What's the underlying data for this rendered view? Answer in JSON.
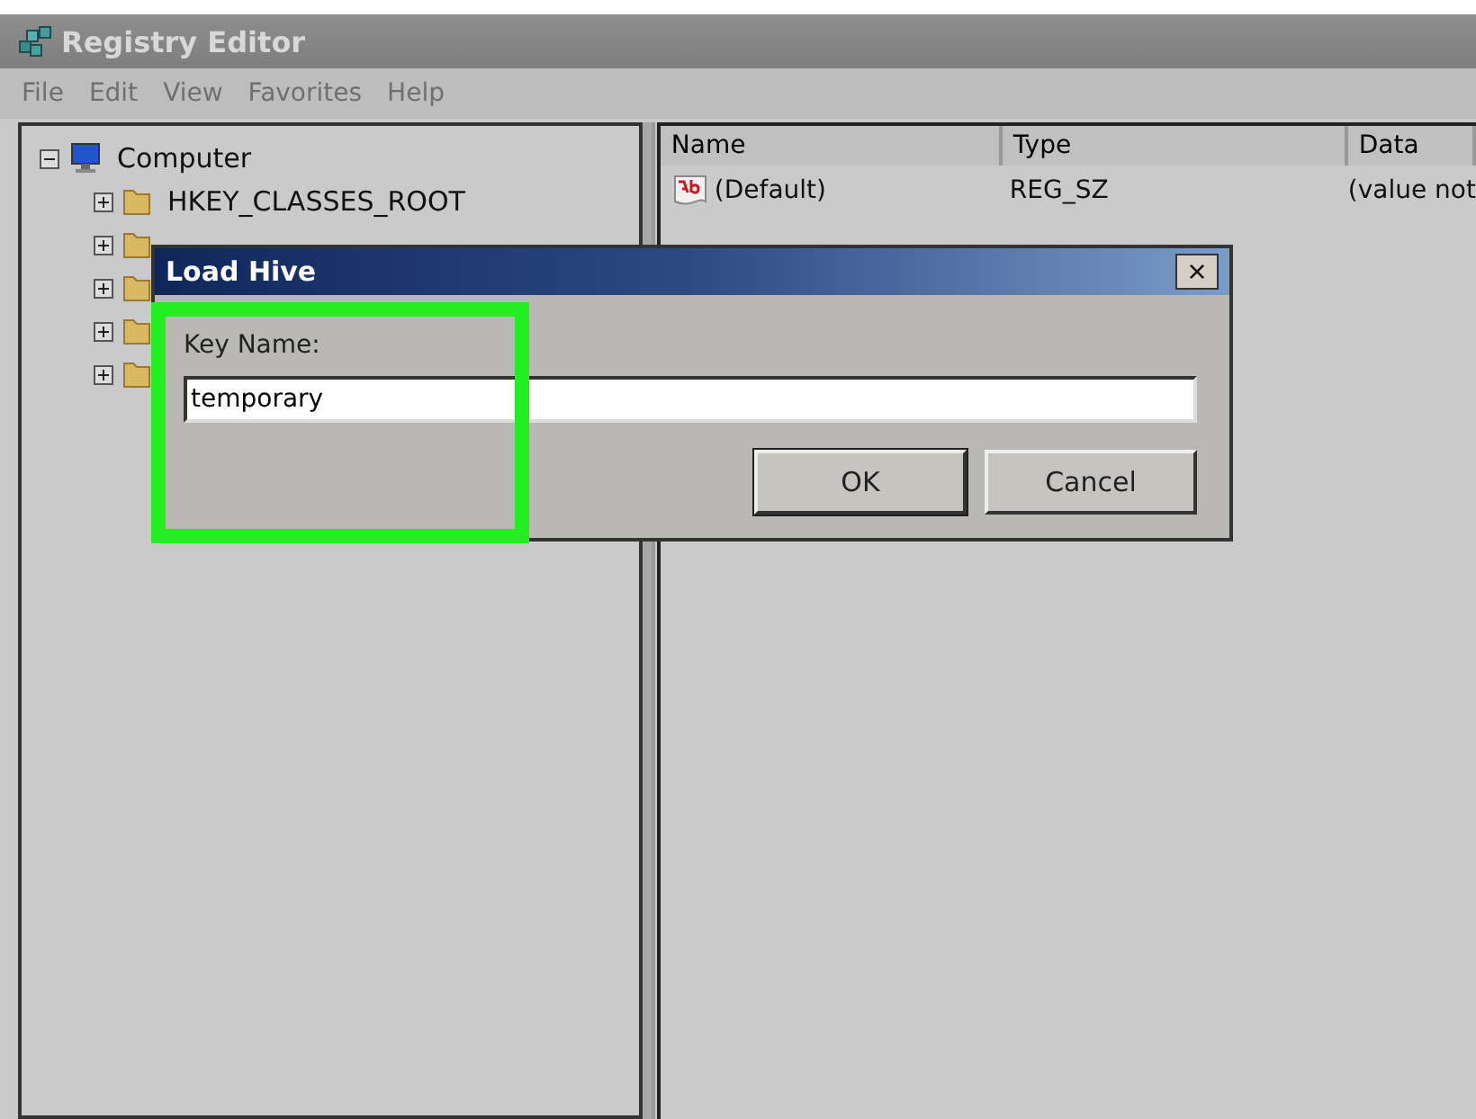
{
  "window": {
    "title": "Registry Editor"
  },
  "menu": [
    "File",
    "Edit",
    "View",
    "Favorites",
    "Help"
  ],
  "tree": {
    "label": "Computer",
    "expanded": true,
    "children": [
      {
        "label": "HKEY_CLASSES_ROOT",
        "expanded": false
      },
      {
        "expanded": false
      },
      {
        "expanded": false
      },
      {
        "expanded": false
      },
      {
        "expanded": false
      }
    ]
  },
  "values": {
    "columns": [
      "Name",
      "Type",
      "Data"
    ],
    "rows": [
      {
        "name": "(Default)",
        "type": "REG_SZ",
        "data": "(value not"
      }
    ]
  },
  "dialog": {
    "title": "Load Hive",
    "close": "×",
    "field": {
      "label": "Key Name:",
      "value": "temporary",
      "highlighted": true
    },
    "buttons": [
      "OK",
      "Cancel"
    ]
  }
}
